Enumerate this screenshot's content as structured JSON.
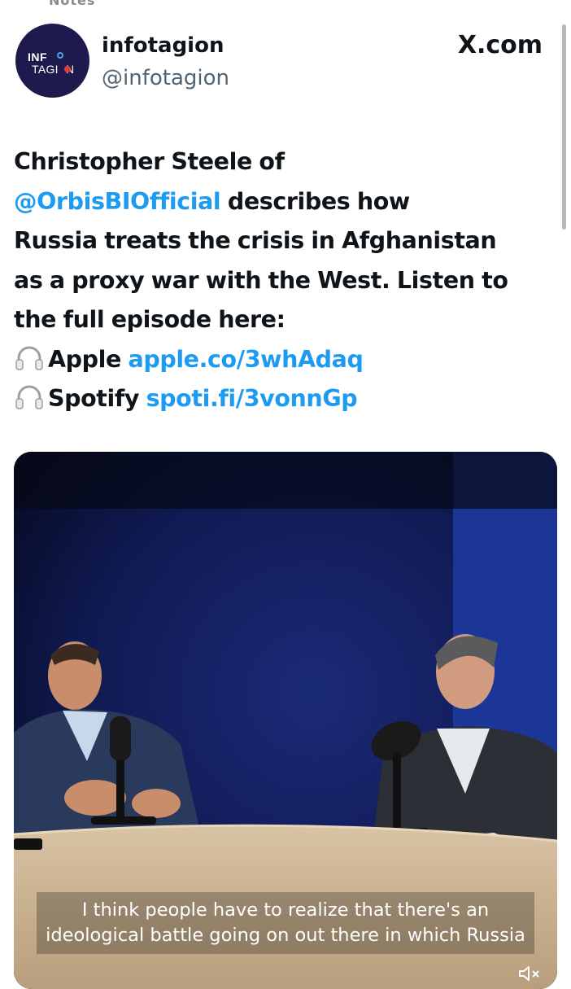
{
  "top_fragment": "Notes",
  "author": {
    "display_name": "infotagion",
    "handle": "@infotagion",
    "avatar_text_line1": "INF",
    "avatar_text_line2": "TAGI",
    "avatar_text_line2_end": "N"
  },
  "source_label": "X.com",
  "tweet": {
    "line1": "Christopher Steele of",
    "mention": "@OrbisBIOfficial",
    "line2_rest": " describes how",
    "line3": "Russia treats the crisis in Afghanistan",
    "line4": "as a proxy war with the West. Listen to",
    "line5": "the full episode here:",
    "apple_label": "Apple ",
    "apple_link": "apple.co/3whAdaq",
    "spotify_label": "Spotify ",
    "spotify_link": "spoti.fi/3vonnGp",
    "headphones_icon": "headphones-icon"
  },
  "video": {
    "caption_line1": "I think people have to realize that there's an",
    "caption_line2": "ideological battle going on out there in which Russia",
    "mute_icon": "speaker-muted-icon"
  },
  "colors": {
    "link": "#1d9bf0",
    "text": "#0f1419",
    "secondary": "#536471",
    "avatar_bg": "#1f1a4d"
  }
}
